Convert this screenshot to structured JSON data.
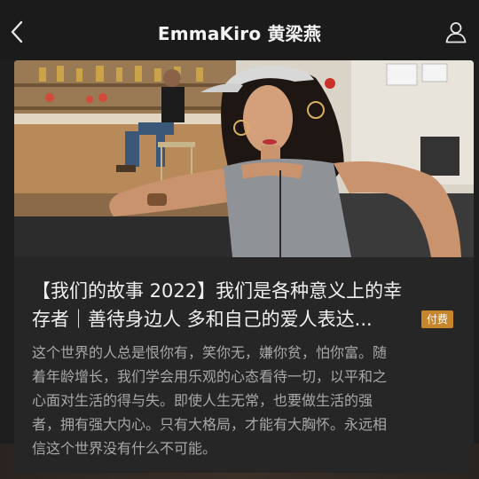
{
  "header": {
    "title": "EmmaKiro 黄梁燕"
  },
  "article": {
    "title_lines": [
      "【我们的故事 2022】我们是各种意义上的幸",
      "存者｜善待身边人 多和自己的爱人表达..."
    ],
    "badge": "付费",
    "desc_lines": [
      "这个世界的人总是恨你有，笑你无，嫌你贫，怕你富。随",
      "着年龄增长，我们学会用乐观的心态看待一切，以平和之",
      "心面对生活的得与失。即使人生无常，也要做生活的强",
      "者，拥有强大内心。只有大格局，才能有大胸怀。永远相",
      "信这个世界没有什么不可能。"
    ]
  },
  "colors": {
    "background": "#1e1e1e",
    "card": "#262626",
    "badge": "#c8862c"
  },
  "icons": {
    "back": "chevron-left-icon",
    "profile": "user-icon"
  }
}
